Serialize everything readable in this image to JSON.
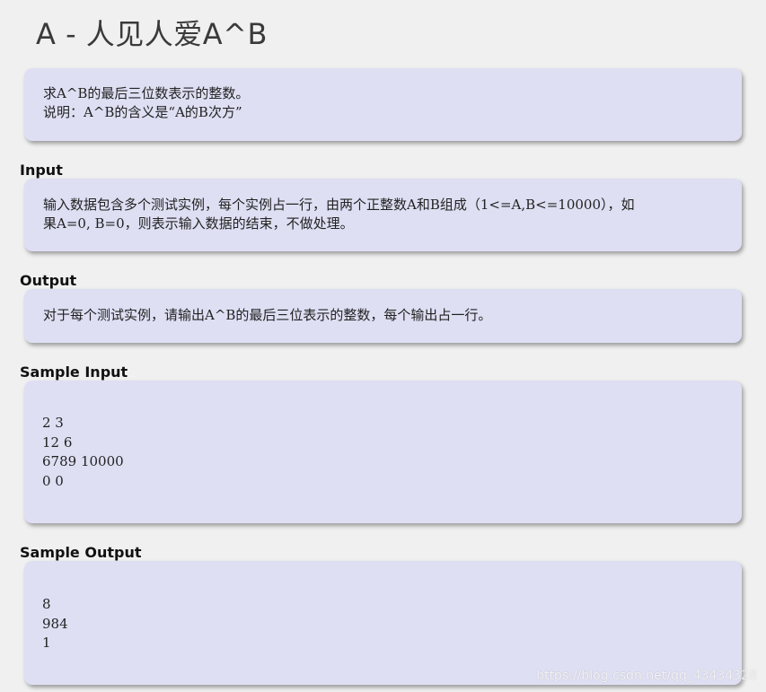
{
  "problem": {
    "title": "A - 人见人爱A^B"
  },
  "description": {
    "lines": [
      "求A^B的最后三位数表示的整数。",
      "说明：A^B的含义是“A的B次方”"
    ]
  },
  "input": {
    "label": "Input",
    "lines": [
      "输入数据包含多个测试实例，每个实例占一行，由两个正整数A和B组成（1<=A,B<=10000），如",
      "果A=0, B=0，则表示输入数据的结束，不做处理。"
    ]
  },
  "output": {
    "label": "Output",
    "lines": [
      "对于每个测试实例，请输出A^B的最后三位表示的整数，每个输出占一行。"
    ]
  },
  "sample_input": {
    "label": "Sample Input",
    "lines": [
      "2 3",
      "12 6",
      "6789 10000",
      "0 0"
    ]
  },
  "sample_output": {
    "label": "Sample Output",
    "lines": [
      "8",
      "984",
      "1"
    ]
  },
  "watermark": "https://blog.csdn.net/qq_43434328"
}
